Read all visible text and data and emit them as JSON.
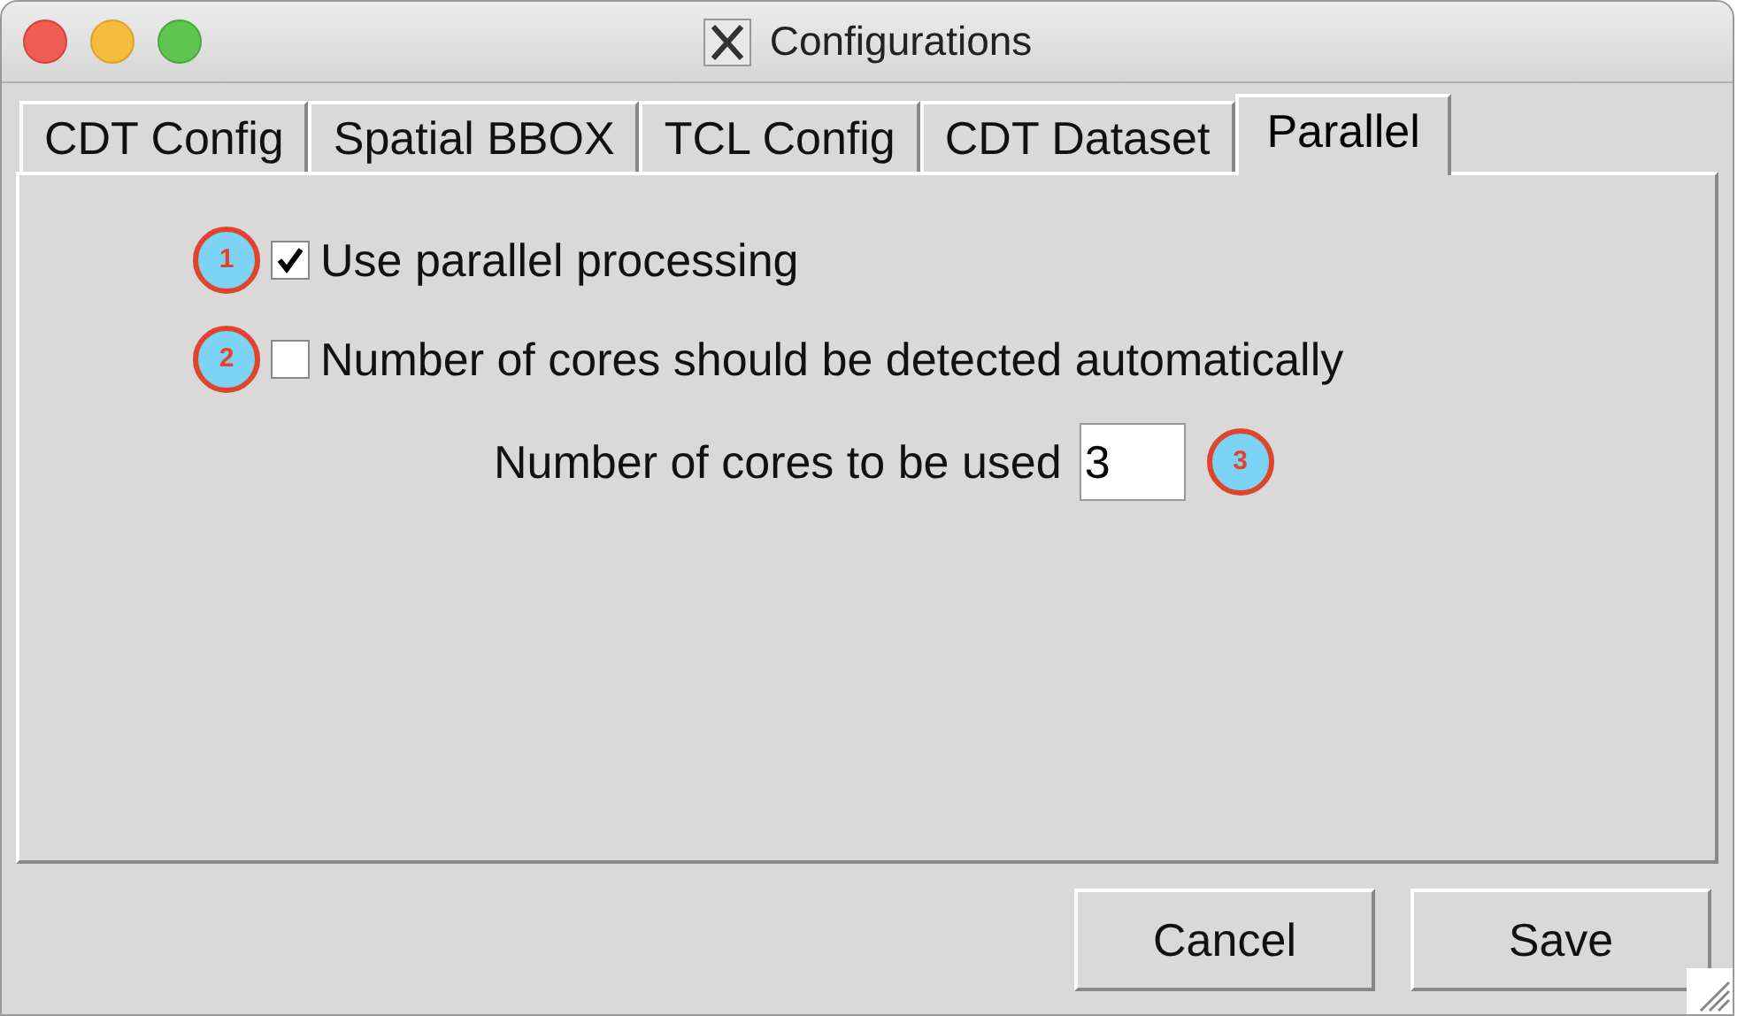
{
  "window": {
    "title": "Configurations"
  },
  "tabs": [
    {
      "label": "CDT Config",
      "selected": false
    },
    {
      "label": "Spatial BBOX",
      "selected": false
    },
    {
      "label": "TCL Config",
      "selected": false
    },
    {
      "label": "CDT Dataset",
      "selected": false
    },
    {
      "label": "Parallel",
      "selected": true
    }
  ],
  "options": [
    {
      "kind": "checkbox",
      "marker": "1",
      "label": "Use parallel processing",
      "checked": true
    },
    {
      "kind": "checkbox",
      "marker": "2",
      "label": "Number of cores should be detected automatically",
      "checked": false
    },
    {
      "kind": "field",
      "marker": "3",
      "label": "Number of cores to be used",
      "value": "3"
    }
  ],
  "buttons": [
    "Cancel",
    "Save"
  ]
}
